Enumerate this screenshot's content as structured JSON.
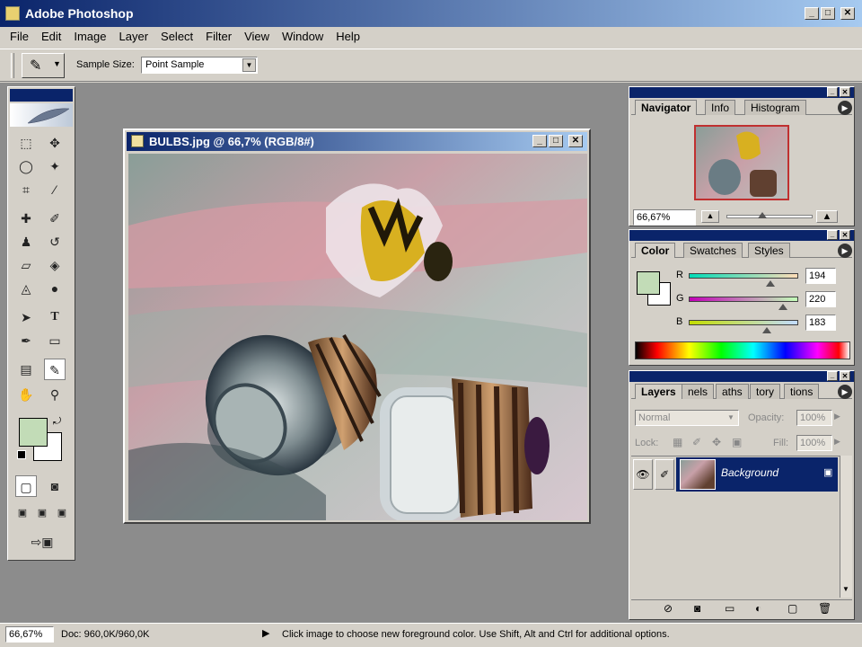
{
  "app": {
    "title": "Adobe Photoshop"
  },
  "menu": [
    "File",
    "Edit",
    "Image",
    "Layer",
    "Select",
    "Filter",
    "View",
    "Window",
    "Help"
  ],
  "options": {
    "sample_size_label": "Sample Size:",
    "sample_size_value": "Point Sample"
  },
  "document": {
    "title": "BULBS.jpg @ 66,7% (RGB/8#)"
  },
  "navigator": {
    "tabs": [
      "Navigator",
      "Info",
      "Histogram"
    ],
    "zoom": "66,67%"
  },
  "color_panel": {
    "tabs": [
      "Color",
      "Swatches",
      "Styles"
    ],
    "r_label": "R",
    "g_label": "G",
    "b_label": "B",
    "r": "194",
    "g": "220",
    "b": "183",
    "foreground_color": "#c2dcb7"
  },
  "layers_panel": {
    "tabs": [
      "Layers",
      "nels",
      "aths",
      "tory",
      "tions"
    ],
    "blend_mode": "Normal",
    "opacity_label": "Opacity:",
    "opacity_value": "100%",
    "lock_label": "Lock:",
    "fill_label": "Fill:",
    "fill_value": "100%",
    "layer_name": "Background"
  },
  "status": {
    "zoom": "66,67%",
    "doc": "Doc: 960,0K/960,0K",
    "message": "Click image to choose new foreground color.  Use Shift, Alt and Ctrl for additional options."
  },
  "colors": {
    "title_blue": "#0a246a",
    "highlight": "#0a246a",
    "chrome": "#d4d0c8",
    "workspace": "#8c8c8c"
  }
}
